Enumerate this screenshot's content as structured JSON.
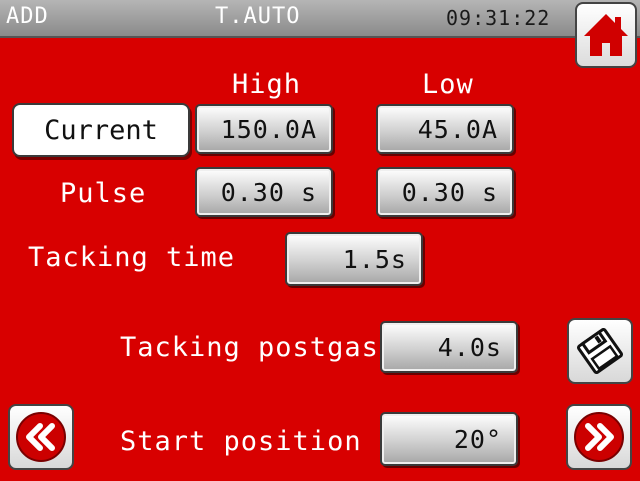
{
  "header": {
    "mode": "ADD",
    "title": "T.AUTO",
    "clock": "09:31:22"
  },
  "columns": {
    "high": "High",
    "low": "Low"
  },
  "current": {
    "label": "Current",
    "high": "150.0A",
    "low": "45.0A"
  },
  "pulse": {
    "label": "Pulse",
    "high": "0.30 s",
    "low": "0.30 s"
  },
  "tacking_time": {
    "label": "Tacking time",
    "value": "1.5s"
  },
  "tacking_postgas": {
    "label": "Tacking postgas",
    "value": "4.0s"
  },
  "start_position": {
    "label": "Start position",
    "value": "20°"
  },
  "icons": {
    "home": "home-icon",
    "save": "floppy-disk-icon",
    "prev": "double-chevron-left-icon",
    "next": "double-chevron-right-icon"
  },
  "colors": {
    "background": "#d80000",
    "accent": "#cc0000"
  }
}
